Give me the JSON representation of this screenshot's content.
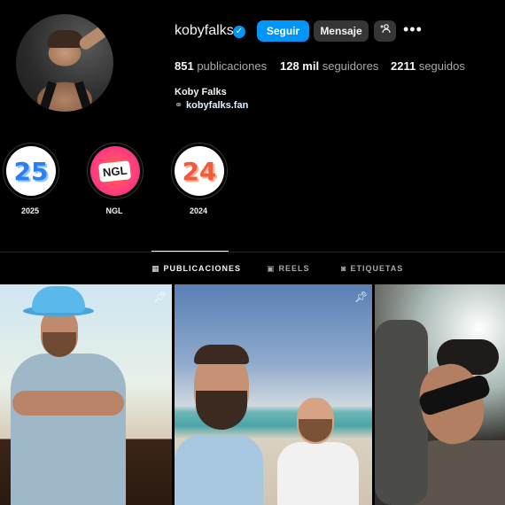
{
  "profile": {
    "username": "kobyfalks",
    "full_name": "Koby Falks",
    "link": "kobyfalks.fan",
    "follow_label": "Seguir",
    "message_label": "Mensaje",
    "stats": {
      "posts_count": "851",
      "posts_label": "publicaciones",
      "followers_count": "128 mil",
      "followers_label": "seguidores",
      "following_count": "2211",
      "following_label": "seguidos"
    }
  },
  "icons": {
    "verified": "verified-check-icon",
    "add_user": "add-user-icon",
    "more": "more-dots-icon",
    "link": "link-icon",
    "pin": "pin-icon",
    "grid": "grid-icon",
    "reels": "reels-icon",
    "tagged": "tagged-icon"
  },
  "highlights": [
    {
      "label": "2025",
      "art": "25"
    },
    {
      "label": "NGL",
      "art": "NGL"
    },
    {
      "label": "2024",
      "art": "24"
    }
  ],
  "tabs": [
    {
      "label": "PUBLICACIONES",
      "active": true
    },
    {
      "label": "REELS",
      "active": false
    },
    {
      "label": "ETIQUETAS",
      "active": false
    }
  ],
  "posts": [
    {
      "pinned": true
    },
    {
      "pinned": true
    },
    {
      "pinned": false
    }
  ],
  "colors": {
    "accent": "#0095f6",
    "background": "#000000",
    "secondary_button": "#363636"
  }
}
